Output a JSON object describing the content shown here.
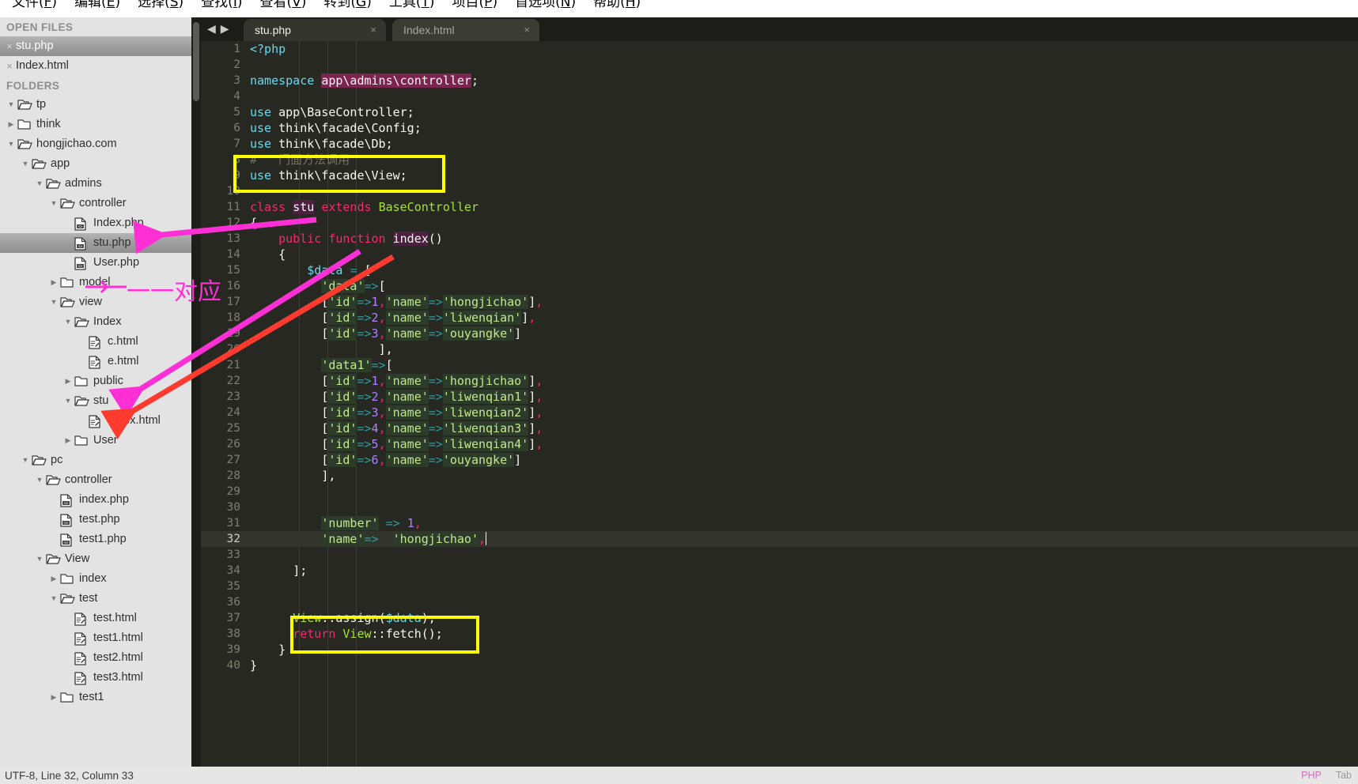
{
  "menu": {
    "items": [
      {
        "label": "文件(F)",
        "accel": "F"
      },
      {
        "label": "编辑(E)",
        "accel": "E"
      },
      {
        "label": "选择(S)",
        "accel": "S"
      },
      {
        "label": "查找(I)",
        "accel": "I"
      },
      {
        "label": "查看(V)",
        "accel": "V"
      },
      {
        "label": "转到(G)",
        "accel": "G"
      },
      {
        "label": "工具(T)",
        "accel": "T"
      },
      {
        "label": "项目(P)",
        "accel": "P"
      },
      {
        "label": "首选项(N)",
        "accel": "N"
      },
      {
        "label": "帮助(H)",
        "accel": "H"
      }
    ]
  },
  "sidebar": {
    "open_files_header": "OPEN FILES",
    "open_files": [
      {
        "name": "stu.php",
        "selected": true,
        "close": "×"
      },
      {
        "name": "Index.html",
        "selected": false,
        "close": "×"
      }
    ],
    "folders_header": "FOLDERS",
    "tree": [
      {
        "label": "tp",
        "depth": 0,
        "type": "folder-open",
        "arrow": "down"
      },
      {
        "label": "think",
        "depth": 0,
        "type": "folder-closed",
        "arrow": "right"
      },
      {
        "label": "hongjichao.com",
        "depth": 0,
        "type": "folder-open",
        "arrow": "down"
      },
      {
        "label": "app",
        "depth": 1,
        "type": "folder-open",
        "arrow": "down"
      },
      {
        "label": "admins",
        "depth": 2,
        "type": "folder-open",
        "arrow": "down"
      },
      {
        "label": "controller",
        "depth": 3,
        "type": "folder-open",
        "arrow": "down"
      },
      {
        "label": "Index.php",
        "depth": 4,
        "type": "file-php",
        "arrow": "none"
      },
      {
        "label": "stu.php",
        "depth": 4,
        "type": "file-php",
        "arrow": "none",
        "selected": true
      },
      {
        "label": "User.php",
        "depth": 4,
        "type": "file-php",
        "arrow": "none"
      },
      {
        "label": "model",
        "depth": 3,
        "type": "folder-closed",
        "arrow": "right"
      },
      {
        "label": "view",
        "depth": 3,
        "type": "folder-open",
        "arrow": "down"
      },
      {
        "label": "Index",
        "depth": 4,
        "type": "folder-open",
        "arrow": "down"
      },
      {
        "label": "c.html",
        "depth": 5,
        "type": "file-html",
        "arrow": "none"
      },
      {
        "label": "e.html",
        "depth": 5,
        "type": "file-html",
        "arrow": "none"
      },
      {
        "label": "public",
        "depth": 4,
        "type": "folder-closed",
        "arrow": "right"
      },
      {
        "label": "stu",
        "depth": 4,
        "type": "folder-open",
        "arrow": "down"
      },
      {
        "label": "Index.html",
        "depth": 5,
        "type": "file-html",
        "arrow": "none"
      },
      {
        "label": "User",
        "depth": 4,
        "type": "folder-closed",
        "arrow": "right"
      },
      {
        "label": "pc",
        "depth": 1,
        "type": "folder-open",
        "arrow": "down"
      },
      {
        "label": "controller",
        "depth": 2,
        "type": "folder-open",
        "arrow": "down"
      },
      {
        "label": "index.php",
        "depth": 3,
        "type": "file-php",
        "arrow": "none"
      },
      {
        "label": "test.php",
        "depth": 3,
        "type": "file-php",
        "arrow": "none"
      },
      {
        "label": "test1.php",
        "depth": 3,
        "type": "file-php",
        "arrow": "none"
      },
      {
        "label": "View",
        "depth": 2,
        "type": "folder-open",
        "arrow": "down"
      },
      {
        "label": "index",
        "depth": 3,
        "type": "folder-closed",
        "arrow": "right"
      },
      {
        "label": "test",
        "depth": 3,
        "type": "folder-open",
        "arrow": "down"
      },
      {
        "label": "test.html",
        "depth": 4,
        "type": "file-html",
        "arrow": "none"
      },
      {
        "label": "test1.html",
        "depth": 4,
        "type": "file-html",
        "arrow": "none"
      },
      {
        "label": "test2.html",
        "depth": 4,
        "type": "file-html",
        "arrow": "none"
      },
      {
        "label": "test3.html",
        "depth": 4,
        "type": "file-html",
        "arrow": "none"
      },
      {
        "label": "test1",
        "depth": 3,
        "type": "folder-closed",
        "arrow": "right"
      }
    ]
  },
  "tabs": {
    "nav_prev": "◀",
    "nav_next": "▶",
    "items": [
      {
        "label": "stu.php",
        "active": true,
        "close": "×"
      },
      {
        "label": "Index.html",
        "active": false,
        "close": "×"
      }
    ]
  },
  "editor": {
    "current_line": 32,
    "lines": [
      {
        "n": 1,
        "text": "<?php"
      },
      {
        "n": 2,
        "text": ""
      },
      {
        "n": 3,
        "text": "namespace app\\admins\\controller;"
      },
      {
        "n": 4,
        "text": ""
      },
      {
        "n": 5,
        "text": "use app\\BaseController;"
      },
      {
        "n": 6,
        "text": "use think\\facade\\Config;"
      },
      {
        "n": 7,
        "text": "use think\\facade\\Db;"
      },
      {
        "n": 8,
        "text": "#   门面方法调用"
      },
      {
        "n": 9,
        "text": "use think\\facade\\View;"
      },
      {
        "n": 10,
        "text": ""
      },
      {
        "n": 11,
        "text": "class stu extends BaseController"
      },
      {
        "n": 12,
        "text": "{"
      },
      {
        "n": 13,
        "text": "    public function index()"
      },
      {
        "n": 14,
        "text": "    {"
      },
      {
        "n": 15,
        "text": "        $data = ["
      },
      {
        "n": 16,
        "text": "          'data'=>["
      },
      {
        "n": 17,
        "text": "          ['id'=>1,'name'=>'hongjichao'],"
      },
      {
        "n": 18,
        "text": "          ['id'=>2,'name'=>'liwenqian'],"
      },
      {
        "n": 19,
        "text": "          ['id'=>3,'name'=>'ouyangke']"
      },
      {
        "n": 20,
        "text": "                  ],"
      },
      {
        "n": 21,
        "text": "          'data1'=>["
      },
      {
        "n": 22,
        "text": "          ['id'=>1,'name'=>'hongjichao'],"
      },
      {
        "n": 23,
        "text": "          ['id'=>2,'name'=>'liwenqian1'],"
      },
      {
        "n": 24,
        "text": "          ['id'=>3,'name'=>'liwenqian2'],"
      },
      {
        "n": 25,
        "text": "          ['id'=>4,'name'=>'liwenqian3'],"
      },
      {
        "n": 26,
        "text": "          ['id'=>5,'name'=>'liwenqian4'],"
      },
      {
        "n": 27,
        "text": "          ['id'=>6,'name'=>'ouyangke']"
      },
      {
        "n": 28,
        "text": "          ],"
      },
      {
        "n": 29,
        "text": ""
      },
      {
        "n": 30,
        "text": ""
      },
      {
        "n": 31,
        "text": "          'number' => 1,"
      },
      {
        "n": 32,
        "text": "          'name'=>  'hongjichao',"
      },
      {
        "n": 33,
        "text": ""
      },
      {
        "n": 34,
        "text": "      ];"
      },
      {
        "n": 35,
        "text": ""
      },
      {
        "n": 36,
        "text": ""
      },
      {
        "n": 37,
        "text": "      View::assign($data);"
      },
      {
        "n": 38,
        "text": "      return View::fetch();"
      },
      {
        "n": 39,
        "text": "    }"
      },
      {
        "n": 40,
        "text": "}"
      }
    ]
  },
  "annotations": {
    "correspondence_note": "一一对应",
    "highlight_color": "#ffff00",
    "arrow_magenta_color": "#ff2fd6",
    "arrow_red_color": "#ff3b30",
    "boxes": [
      {
        "name": "facade-use-box",
        "lines": "8-9"
      },
      {
        "name": "view-assign-box",
        "lines": "37-38"
      }
    ]
  },
  "statusbar": {
    "left": "UTF-8, Line 32, Column 33",
    "syntax": "PHP",
    "tabsize": "Tab"
  }
}
